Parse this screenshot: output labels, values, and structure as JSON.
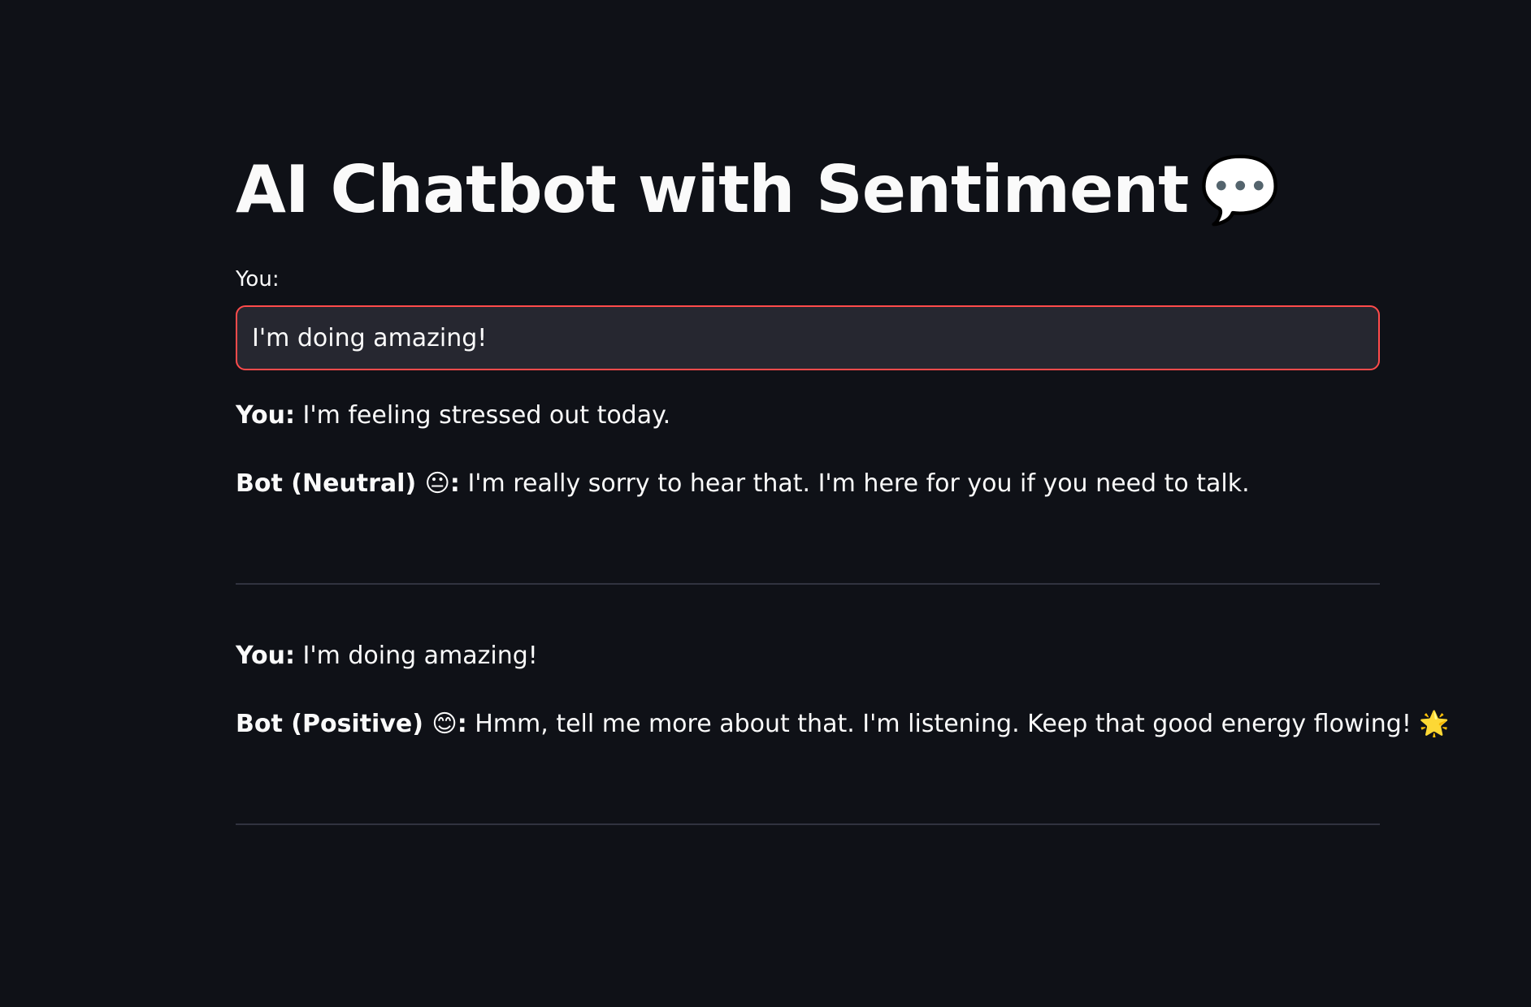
{
  "page": {
    "title": "AI Chatbot with Sentiment",
    "title_icon": "💬",
    "title_icon_name": "speech-balloon-icon"
  },
  "input": {
    "label": "You:",
    "value": "I'm doing amazing!",
    "focus_border_color": "#ff4b4b"
  },
  "conversation": [
    {
      "user_prefix": "You:",
      "user_text": "I'm feeling stressed out today.",
      "bot_prefix": "Bot (Neutral)",
      "bot_emoji": "😐",
      "bot_colon": ":",
      "bot_text": "I'm really sorry to hear that. I'm here for you if you need to talk."
    },
    {
      "user_prefix": "You:",
      "user_text": "I'm doing amazing!",
      "bot_prefix": "Bot (Positive)",
      "bot_emoji": "😊",
      "bot_colon": ":",
      "bot_text": "Hmm, tell me more about that. I'm listening. Keep that good energy flowing! 🌟"
    }
  ],
  "colors": {
    "background": "#0f1117",
    "text": "#fafafa",
    "input_background": "#262730",
    "divider": "#31333f"
  }
}
